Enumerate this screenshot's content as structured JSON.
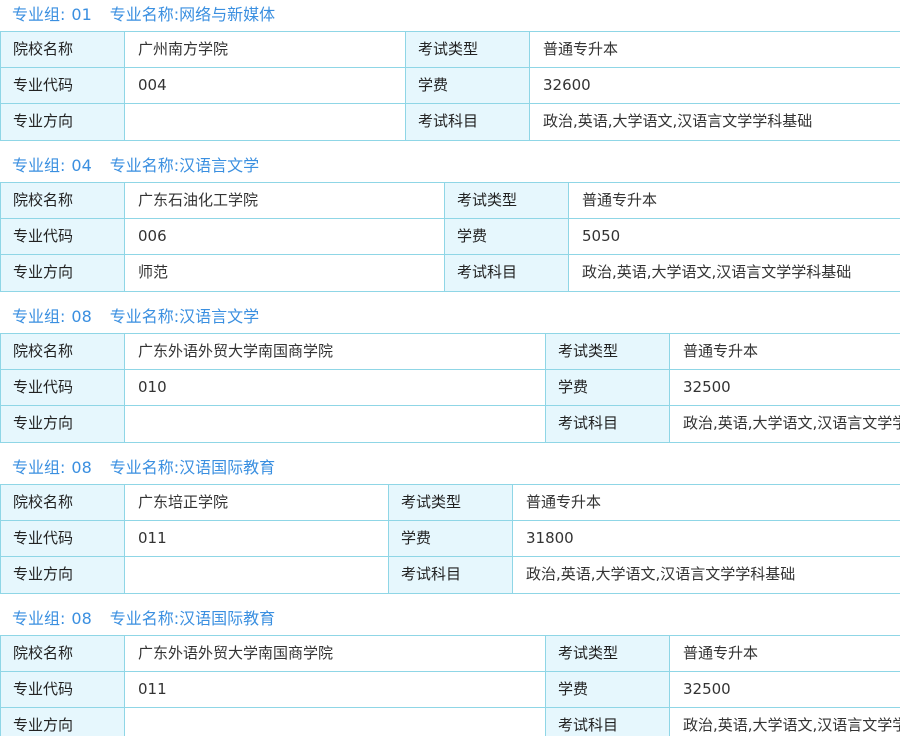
{
  "field_labels": {
    "school": "院校名称",
    "exam_type": "考试类型",
    "major_code": "专业代码",
    "tuition": "学费",
    "direction": "专业方向",
    "exam_subjects": "考试科目"
  },
  "group_prefix": "专业组:",
  "name_prefix": "专业名称:",
  "groups": [
    {
      "group_no": "01",
      "major_name": "网络与新媒体",
      "school": "广州南方学院",
      "exam_type": "普通专升本",
      "major_code": "004",
      "tuition": "32600",
      "direction": "",
      "exam_subjects": "政治,英语,大学语文,汉语言文学学科基础"
    },
    {
      "group_no": "04",
      "major_name": "汉语言文学",
      "school": "广东石油化工学院",
      "exam_type": "普通专升本",
      "major_code": "006",
      "tuition": "5050",
      "direction": "师范",
      "exam_subjects": "政治,英语,大学语文,汉语言文学学科基础"
    },
    {
      "group_no": "08",
      "major_name": "汉语言文学",
      "school": "广东外语外贸大学南国商学院",
      "exam_type": "普通专升本",
      "major_code": "010",
      "tuition": "32500",
      "direction": "",
      "exam_subjects": "政治,英语,大学语文,汉语言文学学科基础"
    },
    {
      "group_no": "08",
      "major_name": "汉语国际教育",
      "school": "广东培正学院",
      "exam_type": "普通专升本",
      "major_code": "011",
      "tuition": "31800",
      "direction": "",
      "exam_subjects": "政治,英语,大学语文,汉语言文学学科基础"
    },
    {
      "group_no": "08",
      "major_name": "汉语国际教育",
      "school": "广东外语外贸大学南国商学院",
      "exam_type": "普通专升本",
      "major_code": "011",
      "tuition": "32500",
      "direction": "",
      "exam_subjects": "政治,英语,大学语文,汉语言文学学科基础"
    }
  ]
}
